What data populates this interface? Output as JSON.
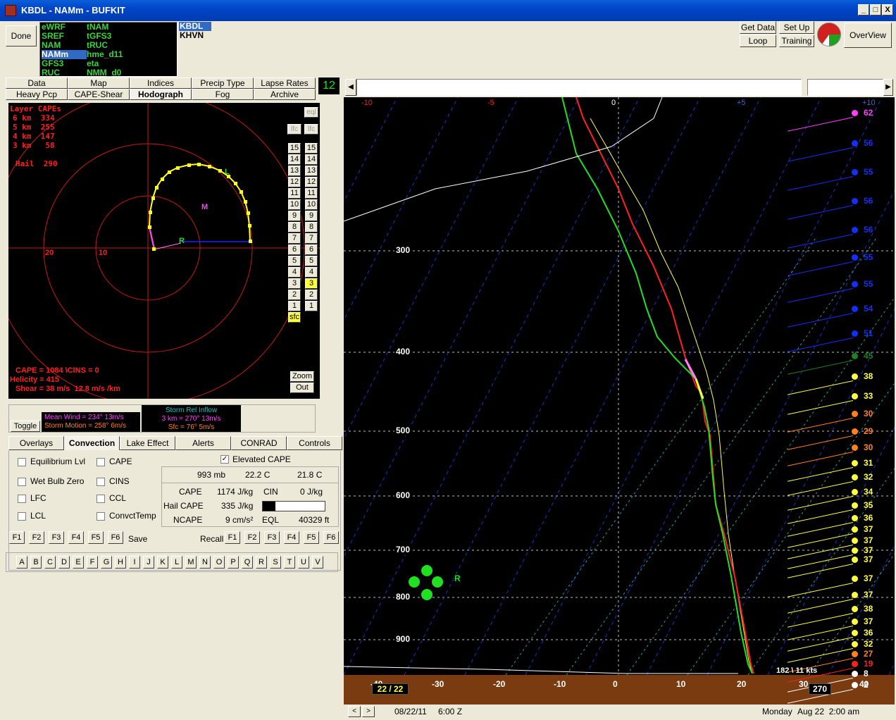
{
  "window": {
    "title": "KBDL - NAMm - BUFKIT",
    "min": "_",
    "max": "□",
    "close": "X"
  },
  "toolbar": {
    "done": "Done",
    "get_data": "Get Data",
    "loop": "Loop",
    "set_up": "Set Up",
    "training": "Training",
    "overview": "OverView"
  },
  "models": {
    "col1": [
      "eWRF",
      "SREF",
      "NAM",
      "NAMm",
      "GFS3",
      "RUC"
    ],
    "col2": [
      "tNAM",
      "tGFS3",
      "tRUC",
      "hme_d11",
      "eta",
      "NMM_d0"
    ],
    "selected": "NAMm"
  },
  "stations": [
    "KBDL",
    "KHVN"
  ],
  "tabs_row1": [
    "Data",
    "Map",
    "Indices",
    "Precip Type",
    "Lapse Rates"
  ],
  "tabs_row2": [
    "Heavy Pcp",
    "CAPE-Shear",
    "Hodograph",
    "Fog",
    "Archive"
  ],
  "hour": "12",
  "hodograph": {
    "layer_title": "Layer CAPEs",
    "layers": [
      "6 km  334",
      "5 km  255",
      "4 km  147",
      "3 km   58"
    ],
    "hail": "Hail  290",
    "ring20": "20",
    "ring10": "10",
    "label_M": "M",
    "label_L": "L",
    "label_R": "R",
    "cape_line": "CAPE = 1084 \\CINS = 0",
    "helicity_line": "Helicity = 415",
    "shear_line": "Shear = 38 m/s  12.8 m/s /km",
    "eql": "eql",
    "lfc": "lfc",
    "levels": [
      "15",
      "14",
      "13",
      "12",
      "11",
      "10",
      "9",
      "8",
      "7",
      "6",
      "5",
      "4",
      "3",
      "2",
      "1"
    ],
    "sfc": "sfc",
    "highlight": "3",
    "zoom": "Zoom",
    "out": "Out"
  },
  "wind": {
    "toggle": "Toggle",
    "mean_wind": "Mean Wind = 234° 13m/s",
    "storm_motion": "Storm Motion = 258° 6m/s",
    "srinflow_title": "Storm Rel Inflow",
    "sr_3km": "3 km = 270° 13m/s",
    "sr_sfc": "Sfc = 76° 5m/s"
  },
  "sub_tabs": [
    "Overlays",
    "Convection",
    "Lake Effect",
    "Alerts",
    "CONRAD",
    "Controls"
  ],
  "sub_tab_selected": "Convection",
  "options_left": [
    "Equilibrium Lvl",
    "Wet Bulb Zero",
    "LFC",
    "LCL"
  ],
  "options_mid": [
    "CAPE",
    "CINS",
    "CCL",
    "ConvctTemp"
  ],
  "elevated_cape": "Elevated CAPE",
  "parcel": {
    "pres": "993 mb",
    "temp": "22.2 C",
    "dew": "21.8 C",
    "cape_label": "CAPE",
    "cape_val": "1174 J/kg",
    "cin_label": "CIN",
    "cin_val": "0 J/kg",
    "hail_label": "Hail CAPE",
    "hail_val": "335 J/kg",
    "ncape_label": "NCAPE",
    "ncape_val": "9 cm/s²",
    "eql_label": "EQL",
    "eql_val": "40329 ft",
    "hail_frac": 0.2
  },
  "fkeys": [
    "F1",
    "F2",
    "F3",
    "F4",
    "F5",
    "F6"
  ],
  "save": "Save",
  "recall": "Recall",
  "letters": [
    "A",
    "B",
    "C",
    "D",
    "E",
    "F",
    "G",
    "H",
    "I",
    "J",
    "K",
    "L",
    "M",
    "N",
    "O",
    "P",
    "Q",
    "R",
    "S",
    "T",
    "U",
    "V"
  ],
  "skewt": {
    "top_ticks": [
      "-10",
      "-5",
      "0",
      "+5",
      "+10"
    ],
    "pressure_labels": [
      "300",
      "400",
      "500",
      "600",
      "700",
      "800",
      "900"
    ],
    "bottom_ticks": [
      "-40",
      "-30",
      "-20",
      "-10",
      "0",
      "10",
      "20",
      "30",
      "40"
    ],
    "wind_speeds": [
      "62",
      "56",
      "55",
      "56",
      "56",
      "55",
      "55",
      "54",
      "51",
      "45",
      "38",
      "33",
      "30",
      "29",
      "30",
      "31",
      "32",
      "34",
      "35",
      "36",
      "37",
      "37",
      "37",
      "37",
      "37",
      "37",
      "38",
      "37",
      "36",
      "32",
      "27",
      "19",
      "8",
      "2"
    ],
    "sfc_wind": "182 \\ 11 kts",
    "td_box": "22 / 22",
    "dir_box": "270",
    "top_label": "10",
    "storm_label": "R"
  },
  "statusbar": {
    "date": "08/22/11",
    "time": "6:00 Z",
    "day": "Monday",
    "datetime": "Aug 22  2:00 am",
    "prev": "<",
    "next": ">"
  },
  "colors": {
    "temp": "#ff2020",
    "dew": "#20e020",
    "wetbulb": "#ffff40",
    "hodo": "#ffff20",
    "ring": "#c81818",
    "brown": "#7a3b10"
  }
}
